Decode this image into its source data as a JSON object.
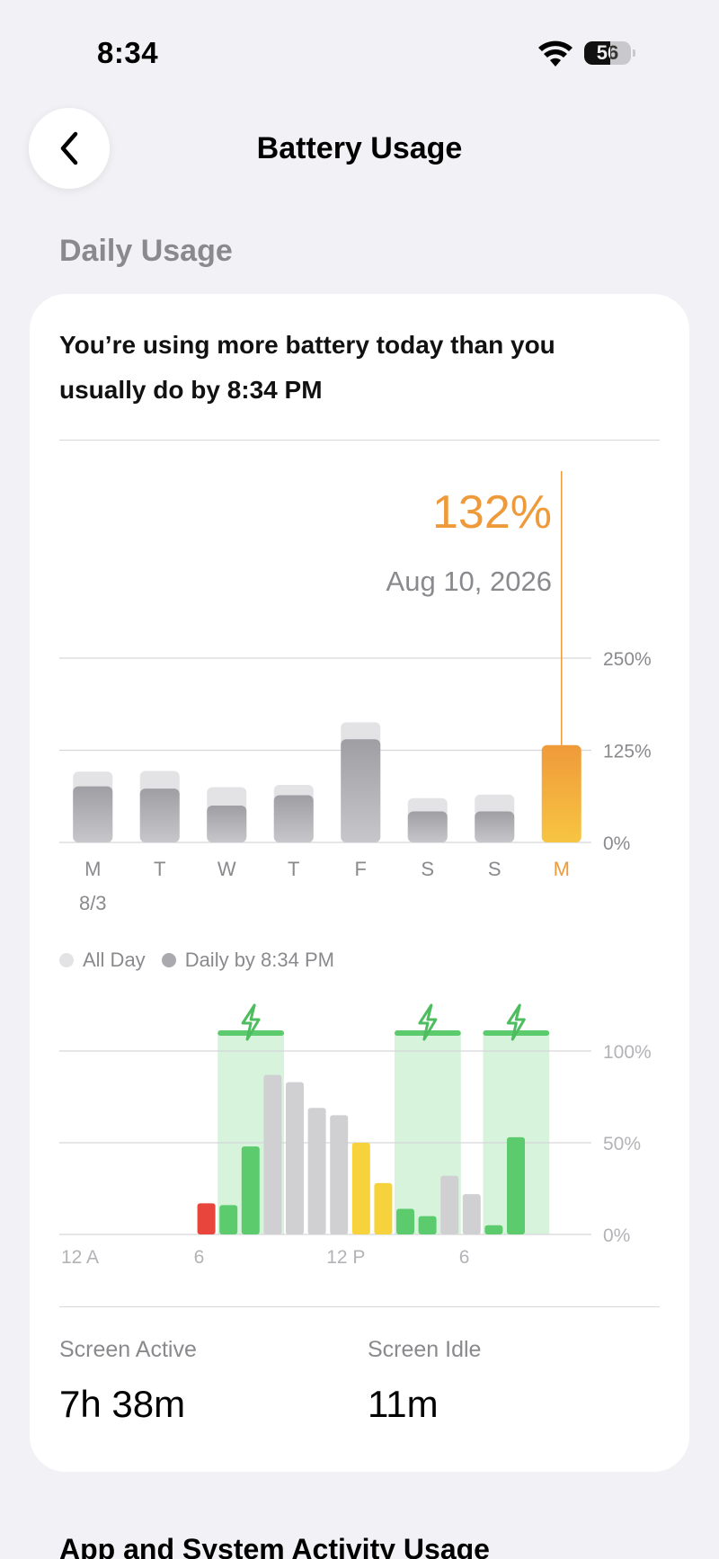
{
  "status_bar": {
    "time": "8:34",
    "battery_level": "56"
  },
  "header": {
    "title": "Battery Usage"
  },
  "section": {
    "title": "Daily Usage"
  },
  "card": {
    "message": "You’re using more battery today than you usually do by 8:34 PM",
    "selected_value": "132%",
    "selected_date": "Aug 10, 2026",
    "colors": {
      "accent": "#ef9a3a",
      "gray_bar": "#a9a9ae",
      "gray_bar_light": "#e3e3e6",
      "green": "#5ccb6e",
      "red": "#e8453c",
      "yellow": "#f6d23c"
    }
  },
  "legend": {
    "all_day": "All Day",
    "daily_by": "Daily by 8:34 PM"
  },
  "stats": {
    "screen_active": {
      "label": "Screen Active",
      "value": "7h 38m"
    },
    "screen_idle": {
      "label": "Screen Idle",
      "value": "11m"
    }
  },
  "next_section": {
    "title": "App and System Activity Usage"
  },
  "chart_data": [
    {
      "type": "bar",
      "categories": [
        "M",
        "T",
        "W",
        "T",
        "F",
        "S",
        "S",
        "M"
      ],
      "x_sublabels": [
        "8/3",
        "",
        "",
        "",
        "",
        "",
        "",
        ""
      ],
      "highlight_index": 7,
      "series": [
        {
          "name": "All Day",
          "values": [
            96,
            97,
            75,
            78,
            163,
            60,
            65,
            132
          ]
        },
        {
          "name": "Daily by 8:34 PM",
          "values": [
            76,
            73,
            50,
            64,
            140,
            42,
            42,
            132
          ]
        }
      ],
      "yticks": [
        "250%",
        "125%",
        "0%"
      ],
      "ylim": [
        0,
        250
      ],
      "grid": true
    },
    {
      "type": "bar",
      "xticks": [
        {
          "label": "12 A",
          "hour": 0
        },
        {
          "label": "6",
          "hour": 6
        },
        {
          "label": "12 P",
          "hour": 12
        },
        {
          "label": "6",
          "hour": 18
        }
      ],
      "yticks": [
        "100%",
        "50%",
        "0%"
      ],
      "ylim": [
        0,
        100
      ],
      "charging_ranges": [
        [
          7,
          9
        ],
        [
          15,
          17
        ],
        [
          19,
          21
        ]
      ],
      "bars": [
        {
          "hour": 6,
          "value": 17,
          "kind": "red"
        },
        {
          "hour": 7,
          "value": 16,
          "kind": "green"
        },
        {
          "hour": 8,
          "value": 48,
          "kind": "green"
        },
        {
          "hour": 9,
          "value": 87,
          "kind": "gray"
        },
        {
          "hour": 10,
          "value": 83,
          "kind": "gray"
        },
        {
          "hour": 11,
          "value": 69,
          "kind": "gray"
        },
        {
          "hour": 12,
          "value": 65,
          "kind": "gray"
        },
        {
          "hour": 13,
          "value": 50,
          "kind": "yellow"
        },
        {
          "hour": 14,
          "value": 28,
          "kind": "yellow"
        },
        {
          "hour": 15,
          "value": 14,
          "kind": "green"
        },
        {
          "hour": 16,
          "value": 10,
          "kind": "green"
        },
        {
          "hour": 17,
          "value": 32,
          "kind": "gray"
        },
        {
          "hour": 18,
          "value": 22,
          "kind": "gray"
        },
        {
          "hour": 19,
          "value": 5,
          "kind": "green"
        },
        {
          "hour": 20,
          "value": 53,
          "kind": "green"
        }
      ],
      "grid": true
    }
  ]
}
